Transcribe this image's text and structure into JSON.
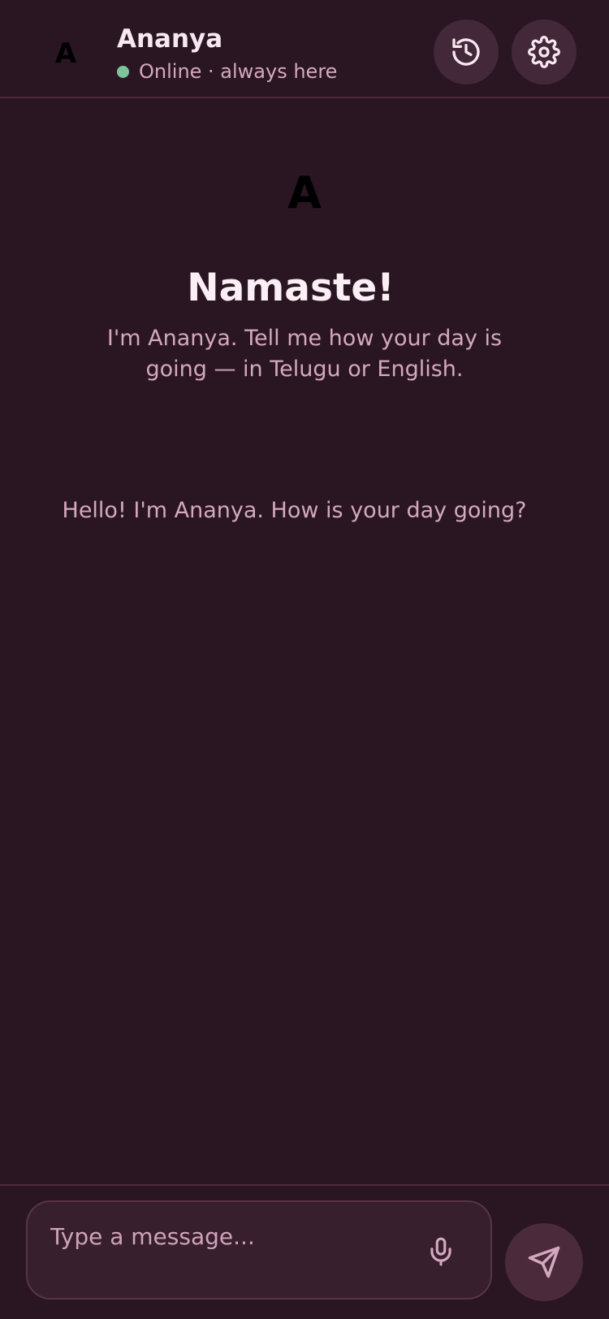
{
  "header": {
    "avatar_letter": "A",
    "name": "Ananya",
    "status": "Online · always here",
    "history_icon": "history-icon",
    "settings_icon": "gear-icon"
  },
  "welcome": {
    "avatar_letter": "A",
    "title": "Namaste!",
    "subtitle": "I'm Ananya. Tell me how your day is going — in Telugu or English."
  },
  "messages": [
    {
      "text": "Hello! I'm Ananya. How is your day going?"
    }
  ],
  "composer": {
    "placeholder": "Type a message...",
    "value": "",
    "mic_icon": "microphone-icon",
    "send_icon": "send-icon"
  },
  "colors": {
    "background": "#2a1622",
    "accent_text": "#d4a8bf",
    "online": "#7cc59a",
    "button_bg": "#43283a"
  }
}
